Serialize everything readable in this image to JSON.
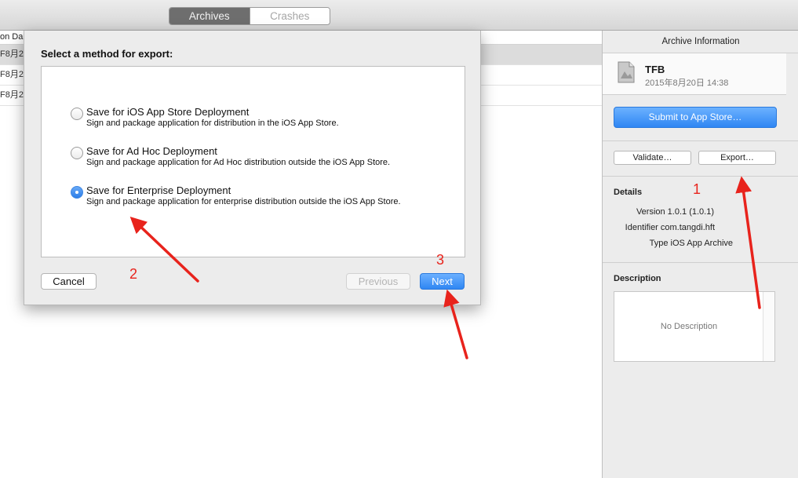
{
  "toolbar": {
    "tabs": [
      {
        "label": "Archives",
        "selected": true
      },
      {
        "label": "Crashes",
        "selected": false
      }
    ]
  },
  "list": {
    "header_fragment": "on Da",
    "rows": [
      {
        "fragment": "F8月2"
      },
      {
        "fragment": "F8月2"
      },
      {
        "fragment": "F8月2"
      }
    ]
  },
  "inspector": {
    "title": "Archive Information",
    "app_name": "TFB",
    "date": "2015年8月20日 14:38",
    "submit_label": "Submit to App Store…",
    "validate_label": "Validate…",
    "export_label": "Export…",
    "details_heading": "Details",
    "version": "Version 1.0.1 (1.0.1)",
    "identifier": "Identifier com.tangdi.hft",
    "type": "Type iOS App Archive",
    "description_heading": "Description",
    "description_placeholder": "No Description"
  },
  "sheet": {
    "title": "Select a method for export:",
    "options": [
      {
        "title": "Save for iOS App Store Deployment",
        "desc": "Sign and package application for distribution in the iOS App Store.",
        "selected": false
      },
      {
        "title": "Save for Ad Hoc Deployment",
        "desc": "Sign and package application for Ad Hoc distribution outside the iOS App Store.",
        "selected": false
      },
      {
        "title": "Save for Enterprise Deployment",
        "desc": "Sign and package application for enterprise distribution outside the iOS App Store.",
        "selected": true
      }
    ],
    "cancel_label": "Cancel",
    "previous_label": "Previous",
    "next_label": "Next"
  },
  "annotations": {
    "step1": "1",
    "step2": "2",
    "step3": "3"
  },
  "colors": {
    "accent": "#2f86f3",
    "annotation": "#e8231c"
  }
}
